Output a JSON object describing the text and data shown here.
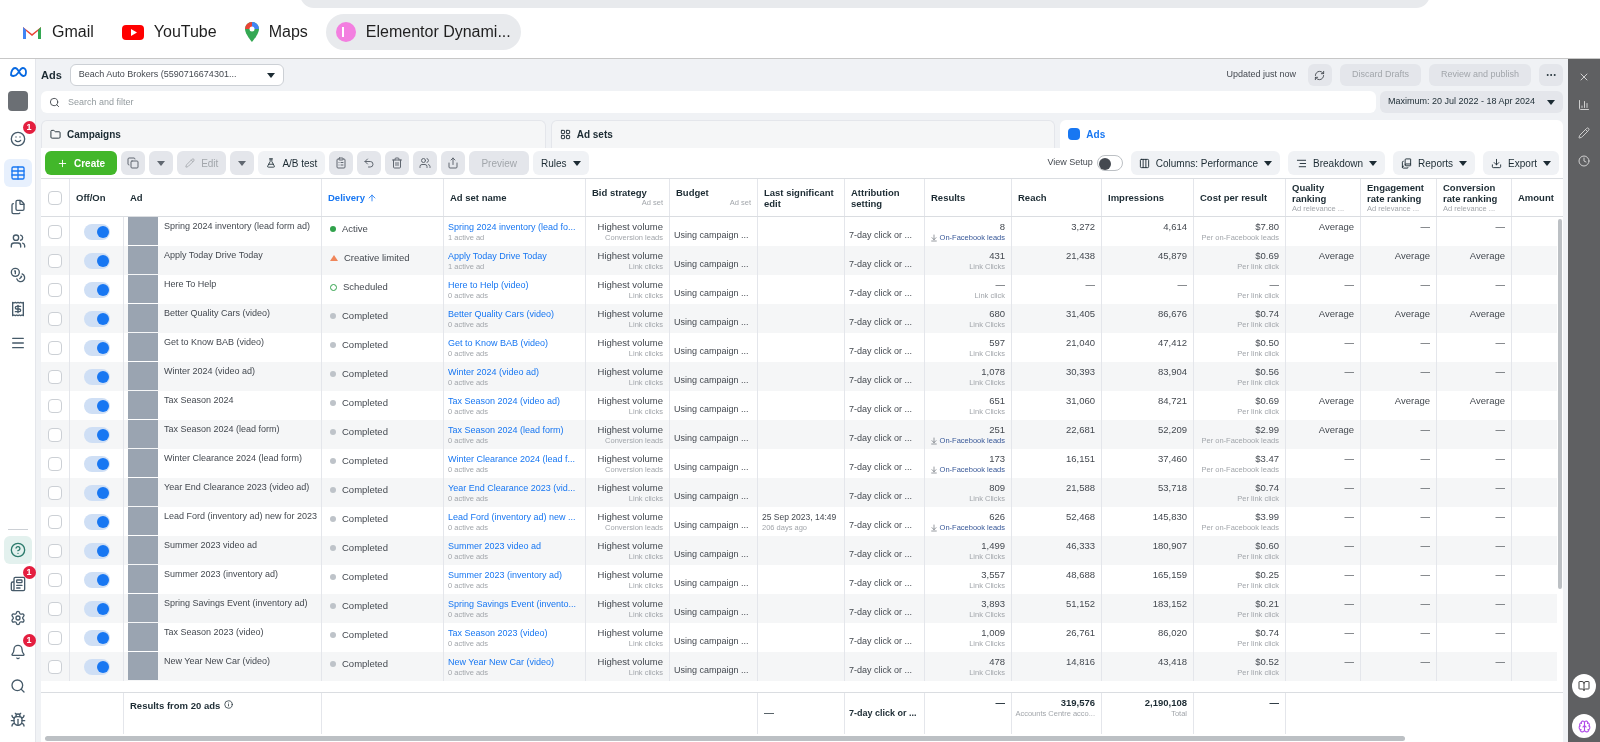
{
  "bookmarks": [
    {
      "label": "Gmail",
      "kind": "gmail"
    },
    {
      "label": "YouTube",
      "kind": "youtube"
    },
    {
      "label": "Maps",
      "kind": "maps"
    },
    {
      "label": "Elementor Dynami...",
      "kind": "elementor"
    }
  ],
  "nav": {
    "top": [
      {
        "kind": "smiley",
        "badge": "1",
        "selected": false
      },
      {
        "kind": "table",
        "selected": true
      },
      {
        "kind": "pages",
        "selected": false
      },
      {
        "kind": "audience",
        "selected": false
      },
      {
        "kind": "coins",
        "selected": false
      },
      {
        "kind": "billing",
        "selected": false
      },
      {
        "kind": "menu",
        "selected": false
      }
    ],
    "bottom": [
      {
        "kind": "help",
        "selected": false
      },
      {
        "kind": "news",
        "badge": "1",
        "selected": false
      },
      {
        "kind": "settings",
        "selected": false
      },
      {
        "kind": "alerts",
        "badge": "1",
        "selected": false
      },
      {
        "kind": "search",
        "selected": false
      },
      {
        "kind": "bug",
        "selected": false
      }
    ]
  },
  "header": {
    "title": "Ads",
    "account": "Beach Auto Brokers (5590716674301...",
    "status": "Updated just now",
    "buttons": [
      {
        "label": "Discard Drafts",
        "disabled": true
      },
      {
        "label": "Review and publish",
        "disabled": true
      }
    ]
  },
  "search": {
    "placeholder": "Search and filter",
    "date_range": "Maximum: 20 Jul 2022 - 18 Apr 2024"
  },
  "tabs": [
    {
      "label": "Campaigns",
      "kind": "campaigns",
      "selected": false
    },
    {
      "label": "Ad sets",
      "kind": "adsets",
      "selected": false
    },
    {
      "label": "Ads",
      "kind": "ads",
      "selected": true
    }
  ],
  "toolbar": {
    "create": "Create",
    "edit": {
      "label": "Edit",
      "disabled": true
    },
    "ab_test": "A/B test",
    "preview": {
      "label": "Preview",
      "disabled": true
    },
    "rules": "Rules",
    "view_setup": {
      "label": "View Setup",
      "on": false
    },
    "right_buttons": [
      {
        "label": "Columns: Performance",
        "kind": "columns"
      },
      {
        "label": "Breakdown",
        "kind": "breakdown"
      },
      {
        "label": "Reports",
        "kind": "reports"
      },
      {
        "label": "Export",
        "kind": "export"
      }
    ]
  },
  "table": {
    "select_all": false,
    "columns": [
      {
        "label": "Off/On",
        "sorted": false
      },
      {
        "label": "Ad",
        "sorted": false
      },
      {
        "label": "Delivery",
        "sorted": true
      },
      {
        "label": "Ad set name",
        "sorted": false
      },
      {
        "label": "Bid strategy",
        "sub": "Ad set",
        "sorted": false
      },
      {
        "label": "Budget",
        "sub": "Ad set",
        "sorted": false
      },
      {
        "label": "Last significant edit",
        "sorted": false
      },
      {
        "label": "Attribution setting",
        "sorted": false
      },
      {
        "label": "Results",
        "sorted": false
      },
      {
        "label": "Reach",
        "sorted": false
      },
      {
        "label": "Impressions",
        "sorted": false
      },
      {
        "label": "Cost per result",
        "sorted": false
      },
      {
        "label": "Quality ranking",
        "sub": "Ad relevance ...",
        "sorted": false
      },
      {
        "label": "Engagement rate ranking",
        "sub": "Ad relevance ...",
        "sorted": false
      },
      {
        "label": "Conversion rate ranking",
        "sub": "Ad relevance ...",
        "sorted": false
      },
      {
        "label": "Amount",
        "sorted": false
      }
    ],
    "rows": [
      {
        "checked": false,
        "on": true,
        "ad": "Spring 2024 inventory (lead form ad)",
        "delivery": {
          "text": "Active",
          "kind": "active"
        },
        "adset": "Spring 2024 inventory (lead fo...",
        "adset_sub": "1 active ad",
        "bid": "Highest volume",
        "bid_sub": "Conversion leads",
        "budget": "Using campaign ...",
        "attribution": "7-day click or ...",
        "results": "8",
        "results_sub": {
          "text": "On-Facebook leads",
          "kind": "lead"
        },
        "reach": "3,272",
        "impressions": "4,614",
        "cost": "$7.80",
        "cost_sub": "Per on-Facebook leads",
        "quality": "Average",
        "engagement": "—",
        "conversion": "—"
      },
      {
        "checked": false,
        "on": true,
        "ad": "Apply Today Drive Today",
        "delivery": {
          "text": "Creative limited",
          "kind": "limited"
        },
        "adset": "Apply Today Drive Today",
        "adset_sub": "1 active ad",
        "bid": "Highest volume",
        "bid_sub": "Link clicks",
        "budget": "Using campaign ...",
        "attribution": "7-day click or ...",
        "results": "431",
        "results_sub": {
          "text": "Link Clicks",
          "kind": "link"
        },
        "reach": "21,438",
        "impressions": "45,879",
        "cost": "$0.69",
        "cost_sub": "Per link click",
        "quality": "Average",
        "engagement": "Average",
        "conversion": "Average"
      },
      {
        "checked": false,
        "on": true,
        "ad": "Here To Help",
        "delivery": {
          "text": "Scheduled",
          "kind": "scheduled"
        },
        "adset": "Here to Help (video)",
        "adset_sub": "0 active ads",
        "bid": "Highest volume",
        "bid_sub": "Link clicks",
        "budget": "Using campaign ...",
        "attribution": "7-day click or ...",
        "results": "—",
        "results_sub": {
          "text": "Link click",
          "kind": "link"
        },
        "reach": "—",
        "impressions": "—",
        "cost": "—",
        "cost_sub": "Per link click",
        "quality": "—",
        "engagement": "—",
        "conversion": "—"
      },
      {
        "checked": false,
        "on": true,
        "ad": "Better Quality Cars (video)",
        "delivery": {
          "text": "Completed",
          "kind": "completed"
        },
        "adset": "Better Quality Cars (video)",
        "adset_sub": "0 active ads",
        "bid": "Highest volume",
        "bid_sub": "Link clicks",
        "budget": "Using campaign ...",
        "attribution": "7-day click or ...",
        "results": "680",
        "results_sub": {
          "text": "Link Clicks",
          "kind": "link"
        },
        "reach": "31,405",
        "impressions": "86,676",
        "cost": "$0.74",
        "cost_sub": "Per link click",
        "quality": "Average",
        "engagement": "Average",
        "conversion": "Average"
      },
      {
        "checked": false,
        "on": true,
        "ad": "Get to Know BAB (video)",
        "delivery": {
          "text": "Completed",
          "kind": "completed"
        },
        "adset": "Get to Know BAB (video)",
        "adset_sub": "0 active ads",
        "bid": "Highest volume",
        "bid_sub": "Link clicks",
        "budget": "Using campaign ...",
        "attribution": "7-day click or ...",
        "results": "597",
        "results_sub": {
          "text": "Link Clicks",
          "kind": "link"
        },
        "reach": "21,040",
        "impressions": "47,412",
        "cost": "$0.50",
        "cost_sub": "Per link click",
        "quality": "—",
        "engagement": "—",
        "conversion": "—"
      },
      {
        "checked": false,
        "on": true,
        "ad": "Winter 2024 (video ad)",
        "delivery": {
          "text": "Completed",
          "kind": "completed"
        },
        "adset": "Winter 2024 (video ad)",
        "adset_sub": "0 active ads",
        "bid": "Highest volume",
        "bid_sub": "Link clicks",
        "budget": "Using campaign ...",
        "attribution": "7-day click or ...",
        "results": "1,078",
        "results_sub": {
          "text": "Link Clicks",
          "kind": "link"
        },
        "reach": "30,393",
        "impressions": "83,904",
        "cost": "$0.56",
        "cost_sub": "Per link click",
        "quality": "—",
        "engagement": "—",
        "conversion": "—"
      },
      {
        "checked": false,
        "on": true,
        "ad": "Tax Season 2024",
        "delivery": {
          "text": "Completed",
          "kind": "completed"
        },
        "adset": "Tax Season 2024 (video ad)",
        "adset_sub": "0 active ads",
        "bid": "Highest volume",
        "bid_sub": "Link clicks",
        "budget": "Using campaign ...",
        "attribution": "7-day click or ...",
        "results": "651",
        "results_sub": {
          "text": "Link Clicks",
          "kind": "link"
        },
        "reach": "31,060",
        "impressions": "84,721",
        "cost": "$0.69",
        "cost_sub": "Per link click",
        "quality": "Average",
        "engagement": "Average",
        "conversion": "Average"
      },
      {
        "checked": false,
        "on": true,
        "ad": "Tax Season 2024 (lead form)",
        "delivery": {
          "text": "Completed",
          "kind": "completed"
        },
        "adset": "Tax Season 2024 (lead form)",
        "adset_sub": "0 active ads",
        "bid": "Highest volume",
        "bid_sub": "Conversion leads",
        "budget": "Using campaign ...",
        "attribution": "7-day click or ...",
        "results": "251",
        "results_sub": {
          "text": "On-Facebook leads",
          "kind": "lead"
        },
        "reach": "22,681",
        "impressions": "52,209",
        "cost": "$2.99",
        "cost_sub": "Per on-Facebook leads",
        "quality": "Average",
        "engagement": "—",
        "conversion": "—"
      },
      {
        "checked": false,
        "on": true,
        "ad": "Winter Clearance 2024 (lead form)",
        "delivery": {
          "text": "Completed",
          "kind": "completed"
        },
        "adset": "Winter Clearance 2024 (lead f...",
        "adset_sub": "0 active ads",
        "bid": "Highest volume",
        "bid_sub": "Conversion leads",
        "budget": "Using campaign ...",
        "attribution": "7-day click or ...",
        "results": "173",
        "results_sub": {
          "text": "On-Facebook leads",
          "kind": "lead"
        },
        "reach": "16,151",
        "impressions": "37,460",
        "cost": "$3.47",
        "cost_sub": "Per on-Facebook leads",
        "quality": "—",
        "engagement": "—",
        "conversion": "—"
      },
      {
        "checked": false,
        "on": true,
        "ad": "Year End Clearance 2023 (video ad)",
        "delivery": {
          "text": "Completed",
          "kind": "completed"
        },
        "adset": "Year End Clearance 2023 (vid...",
        "adset_sub": "0 active ads",
        "bid": "Highest volume",
        "bid_sub": "Link clicks",
        "budget": "Using campaign ...",
        "attribution": "7-day click or ...",
        "results": "809",
        "results_sub": {
          "text": "Link Clicks",
          "kind": "link"
        },
        "reach": "21,588",
        "impressions": "53,718",
        "cost": "$0.74",
        "cost_sub": "Per link click",
        "quality": "—",
        "engagement": "—",
        "conversion": "—"
      },
      {
        "checked": false,
        "on": true,
        "ad": "Lead Ford (inventory ad) new for 2023",
        "delivery": {
          "text": "Completed",
          "kind": "completed"
        },
        "adset": "Lead Ford (inventory ad) new ...",
        "adset_sub": "0 active ads",
        "bid": "Highest volume",
        "bid_sub": "Conversion leads",
        "budget": "Using campaign ...",
        "last_edit": "25 Sep 2023, 14:49",
        "last_edit_sub": "206 days ago",
        "attribution": "7-day click or ...",
        "results": "626",
        "results_sub": {
          "text": "On-Facebook leads",
          "kind": "lead"
        },
        "reach": "52,468",
        "impressions": "145,830",
        "cost": "$3.99",
        "cost_sub": "Per on-Facebook leads",
        "quality": "—",
        "engagement": "—",
        "conversion": "—"
      },
      {
        "checked": false,
        "on": true,
        "ad": "Summer 2023 video ad",
        "delivery": {
          "text": "Completed",
          "kind": "completed"
        },
        "adset": "Summer 2023 video ad",
        "adset_sub": "0 active ads",
        "bid": "Highest volume",
        "bid_sub": "Link clicks",
        "budget": "Using campaign ...",
        "attribution": "7-day click or ...",
        "results": "1,499",
        "results_sub": {
          "text": "Link Clicks",
          "kind": "link"
        },
        "reach": "46,333",
        "impressions": "180,907",
        "cost": "$0.60",
        "cost_sub": "Per link click",
        "quality": "—",
        "engagement": "—",
        "conversion": "—"
      },
      {
        "checked": false,
        "on": true,
        "ad": "Summer 2023 (inventory ad)",
        "delivery": {
          "text": "Completed",
          "kind": "completed"
        },
        "adset": "Summer 2023 (inventory ad)",
        "adset_sub": "0 active ads",
        "bid": "Highest volume",
        "bid_sub": "Link clicks",
        "budget": "Using campaign ...",
        "attribution": "7-day click or ...",
        "results": "3,557",
        "results_sub": {
          "text": "Link Clicks",
          "kind": "link"
        },
        "reach": "48,688",
        "impressions": "165,159",
        "cost": "$0.25",
        "cost_sub": "Per link click",
        "quality": "—",
        "engagement": "—",
        "conversion": "—"
      },
      {
        "checked": false,
        "on": true,
        "ad": "Spring Savings Event (inventory ad)",
        "delivery": {
          "text": "Completed",
          "kind": "completed"
        },
        "adset": "Spring Savings Event (invento...",
        "adset_sub": "0 active ads",
        "bid": "Highest volume",
        "bid_sub": "Link clicks",
        "budget": "Using campaign ...",
        "attribution": "7-day click or ...",
        "results": "3,893",
        "results_sub": {
          "text": "Link Clicks",
          "kind": "link"
        },
        "reach": "51,152",
        "impressions": "183,152",
        "cost": "$0.21",
        "cost_sub": "Per link click",
        "quality": "—",
        "engagement": "—",
        "conversion": "—"
      },
      {
        "checked": false,
        "on": true,
        "ad": "Tax Season 2023 (video)",
        "delivery": {
          "text": "Completed",
          "kind": "completed"
        },
        "adset": "Tax Season 2023 (video)",
        "adset_sub": "0 active ads",
        "bid": "Highest volume",
        "bid_sub": "Link clicks",
        "budget": "Using campaign ...",
        "attribution": "7-day click or ...",
        "results": "1,009",
        "results_sub": {
          "text": "Link Clicks",
          "kind": "link"
        },
        "reach": "26,761",
        "impressions": "86,020",
        "cost": "$0.74",
        "cost_sub": "Per link click",
        "quality": "—",
        "engagement": "—",
        "conversion": "—"
      },
      {
        "checked": false,
        "on": true,
        "ad": "New Year New Car (video)",
        "delivery": {
          "text": "Completed",
          "kind": "completed"
        },
        "adset": "New Year New Car (video)",
        "adset_sub": "0 active ads",
        "bid": "Highest volume",
        "bid_sub": "Link clicks",
        "budget": "Using campaign ...",
        "attribution": "7-day click or ...",
        "results": "478",
        "results_sub": {
          "text": "Link Clicks",
          "kind": "link"
        },
        "reach": "14,816",
        "impressions": "43,418",
        "cost": "$0.52",
        "cost_sub": "Per link click",
        "quality": "—",
        "engagement": "—",
        "conversion": "—"
      }
    ],
    "footer": {
      "label": "Results from 20 ads",
      "last_edit": "—",
      "attribution": "7-day click or ...",
      "results": "—",
      "reach": "319,576",
      "reach_sub": "Accounts Centre acco...",
      "impressions": "2,190,108",
      "impressions_sub": "Total",
      "cost": "—"
    }
  }
}
